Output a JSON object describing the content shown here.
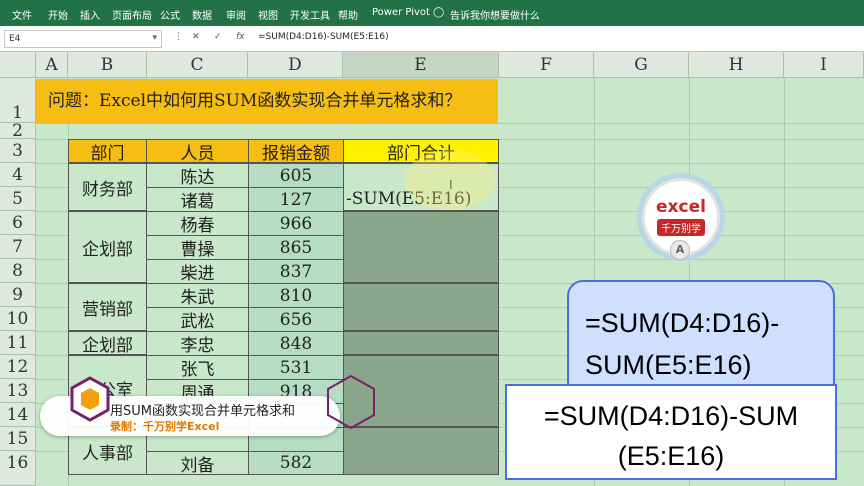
{
  "ribbon": {
    "tabs": [
      "文件",
      "开始",
      "插入",
      "页面布局",
      "公式",
      "数据",
      "审阅",
      "视图",
      "开发工具",
      "帮助",
      "Power Pivot"
    ],
    "tell_me": "告诉我你想要做什么"
  },
  "formula_bar": {
    "name_box": "E4",
    "formula": "=SUM(D4:D16)-SUM(E5:E16)"
  },
  "columns": [
    "A",
    "B",
    "C",
    "D",
    "E",
    "F",
    "G",
    "H",
    "I"
  ],
  "rows": [
    "1",
    "2",
    "3",
    "4",
    "5",
    "6",
    "7",
    "8",
    "9",
    "10",
    "11",
    "12",
    "13",
    "14",
    "15",
    "16"
  ],
  "sheet": {
    "title": "问题：Excel中如何用SUM函数实现合并单元格求和？",
    "headers": {
      "dept": "部门",
      "person": "人员",
      "amount": "报销金额",
      "total": "部门合计"
    },
    "depts": [
      "财务部",
      "企划部",
      "营销部",
      "企划部",
      "办公室",
      "人事部"
    ],
    "people": [
      "陈达",
      "诸葛",
      "杨春",
      "曹操",
      "柴进",
      "朱武",
      "武松",
      "李忠",
      "张飞",
      "周通",
      "",
      "",
      "刘备"
    ],
    "amounts": [
      "605",
      "127",
      "966",
      "865",
      "837",
      "810",
      "656",
      "848",
      "531",
      "918",
      "",
      "",
      "582"
    ],
    "e5_text": "-SUM(E5:E16)"
  },
  "overlay": {
    "logo_text": "excel",
    "logo_sub": "千万别学",
    "logo_badge": "A",
    "bubble_line1": "=SUM(D4:D16)-",
    "bubble_line2": "SUM(E5:E16)",
    "box_line1": "=SUM(D4:D16)-SUM",
    "box_line2": "(E5:E16)",
    "banner_title": "用SUM函数实现合并单元格求和",
    "banner_sub": "录制：千万别学Excel"
  }
}
